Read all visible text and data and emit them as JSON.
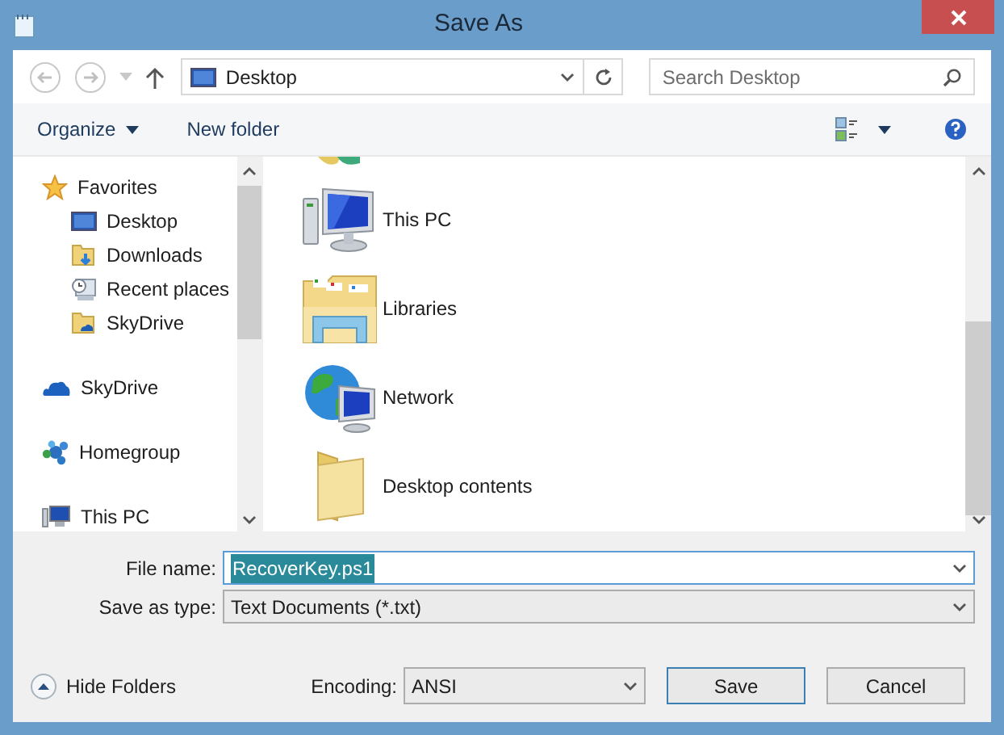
{
  "window": {
    "title": "Save As"
  },
  "nav": {
    "address": "Desktop",
    "search_placeholder": "Search Desktop"
  },
  "toolbar": {
    "organize": "Organize",
    "new_folder": "New folder"
  },
  "sidebar": {
    "groups": [
      {
        "label": "Favorites",
        "kind": "star",
        "children": [
          {
            "label": "Desktop",
            "kind": "desktop"
          },
          {
            "label": "Downloads",
            "kind": "downloads"
          },
          {
            "label": "Recent places",
            "kind": "recent"
          },
          {
            "label": "SkyDrive",
            "kind": "folder"
          }
        ]
      },
      {
        "label": "SkyDrive",
        "kind": "cloud"
      },
      {
        "label": "Homegroup",
        "kind": "homegroup"
      },
      {
        "label": "This PC",
        "kind": "pc"
      }
    ]
  },
  "items": [
    {
      "label": "This PC",
      "kind": "pc"
    },
    {
      "label": "Libraries",
      "kind": "libraries"
    },
    {
      "label": "Network",
      "kind": "network"
    },
    {
      "label": "Desktop contents",
      "kind": "folder"
    }
  ],
  "form": {
    "file_name": {
      "label": "File name:",
      "value": "RecoverKey.ps1",
      "text_selected": true
    },
    "save_type": {
      "label": "Save as type:",
      "value": "Text Documents (*.txt)"
    }
  },
  "hide_folders": "Hide Folders",
  "encoding": {
    "label": "Encoding:",
    "value": "ANSI"
  },
  "buttons": [
    {
      "label": "Save",
      "default": true
    },
    {
      "label": "Cancel",
      "default": false
    }
  ]
}
